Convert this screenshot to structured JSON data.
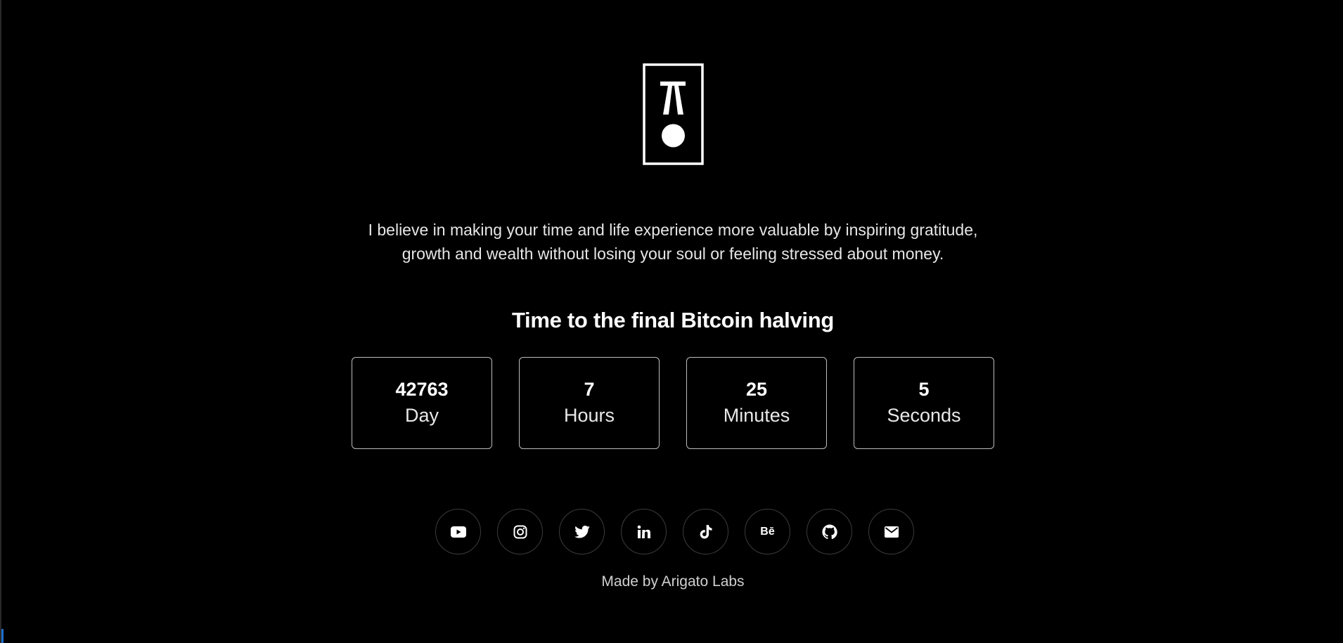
{
  "tagline": {
    "line1": "I believe in making your time and life experience more valuable by inspiring gratitude,",
    "line2": "growth and wealth without losing your soul or feeling stressed about money."
  },
  "heading": "Time to the final Bitcoin halving",
  "countdown": [
    {
      "value": "42763",
      "unit": "Day"
    },
    {
      "value": "7",
      "unit": "Hours"
    },
    {
      "value": "25",
      "unit": "Minutes"
    },
    {
      "value": "5",
      "unit": "Seconds"
    }
  ],
  "socials": [
    {
      "icon": "youtube-icon"
    },
    {
      "icon": "instagram-icon"
    },
    {
      "icon": "twitter-icon"
    },
    {
      "icon": "linkedin-icon"
    },
    {
      "icon": "tiktok-icon"
    },
    {
      "icon": "behance-icon",
      "label": "Bē"
    },
    {
      "icon": "github-icon"
    },
    {
      "icon": "email-icon"
    }
  ],
  "footer": "Made by Arigato Labs",
  "colors": {
    "background": "#000000",
    "text": "#ffffff",
    "border": "#bdbdbd"
  }
}
